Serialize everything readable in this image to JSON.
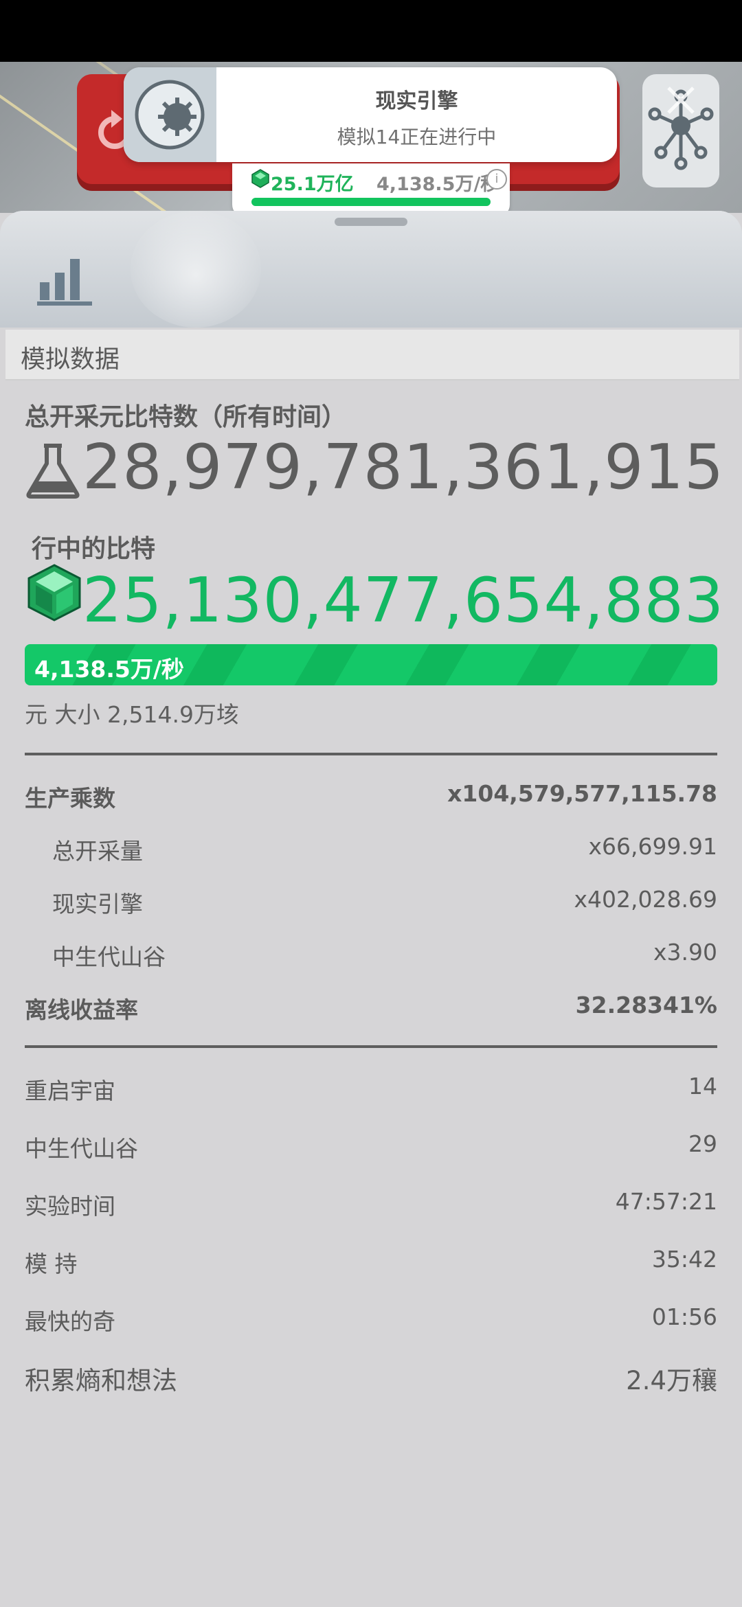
{
  "header": {
    "notif_title": "现实引擎",
    "notif_subtitle": "模拟14正在进行中",
    "pill_amount": "25.1万亿",
    "pill_rate": "4,138.5万/秒",
    "pill_info": "i",
    "pill_progress": 1.0
  },
  "section_title": "模拟数据",
  "total_label": "总开采元比特数（所有时间）",
  "total_value": "28,979,781,361,915",
  "current_label": "行中的比特",
  "current_value": "25,130,477,654,883",
  "rate": "4,138.5万/秒",
  "size_text": "元 大小 2,514.9万垓",
  "production": {
    "label": "生产乘数",
    "value": "x104,579,577,115.78",
    "items": [
      {
        "label": "总开采量",
        "value": "x66,699.91"
      },
      {
        "label": "现实引擎",
        "value": "x402,028.69"
      },
      {
        "label": "中生代山谷",
        "value": "x3.90"
      }
    ],
    "offline_label": "离线收益率",
    "offline_value": "32.28341%"
  },
  "stats": [
    {
      "label": "重启宇宙",
      "value": "14"
    },
    {
      "label": "中生代山谷",
      "value": "29"
    },
    {
      "label": "实验时间",
      "value": "47:57:21"
    },
    {
      "label": "模 持",
      "value": "35:42"
    },
    {
      "label": "最快的奇",
      "value": "01:56"
    }
  ],
  "entropy": {
    "label": "积累熵和想法",
    "value": "2.4万穰"
  },
  "colors": {
    "accent_green": "#12b862",
    "danger_red": "#c42a2a"
  },
  "icons": [
    "restart-icon",
    "gear-icon",
    "network-icon",
    "gem-icon",
    "bar-chart-icon",
    "flask-icon",
    "info-icon"
  ]
}
